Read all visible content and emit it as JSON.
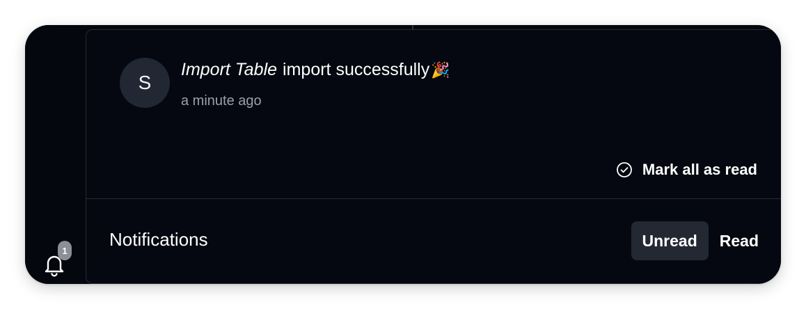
{
  "badge": {
    "count": "1"
  },
  "notification": {
    "avatar_initial": "S",
    "title_emphasis": "Import Table",
    "title_rest": "import successfully",
    "emoji": "🎉",
    "time": "a minute ago"
  },
  "actions": {
    "mark_all": "Mark all as read"
  },
  "footer": {
    "title": "Notifications",
    "tabs": [
      {
        "label": "Unread",
        "active": true
      },
      {
        "label": "Read",
        "active": false
      }
    ]
  },
  "icons": {
    "bell": "bell-icon",
    "check_circle": "check-circle-icon",
    "party": "party-popper-icon"
  },
  "colors": {
    "background": "#05070f",
    "panel_border": "#262b36",
    "avatar_bg": "#222833",
    "active_tab_bg": "#232833",
    "muted_text": "#9aa0ab",
    "badge_bg": "#8c8f96"
  }
}
